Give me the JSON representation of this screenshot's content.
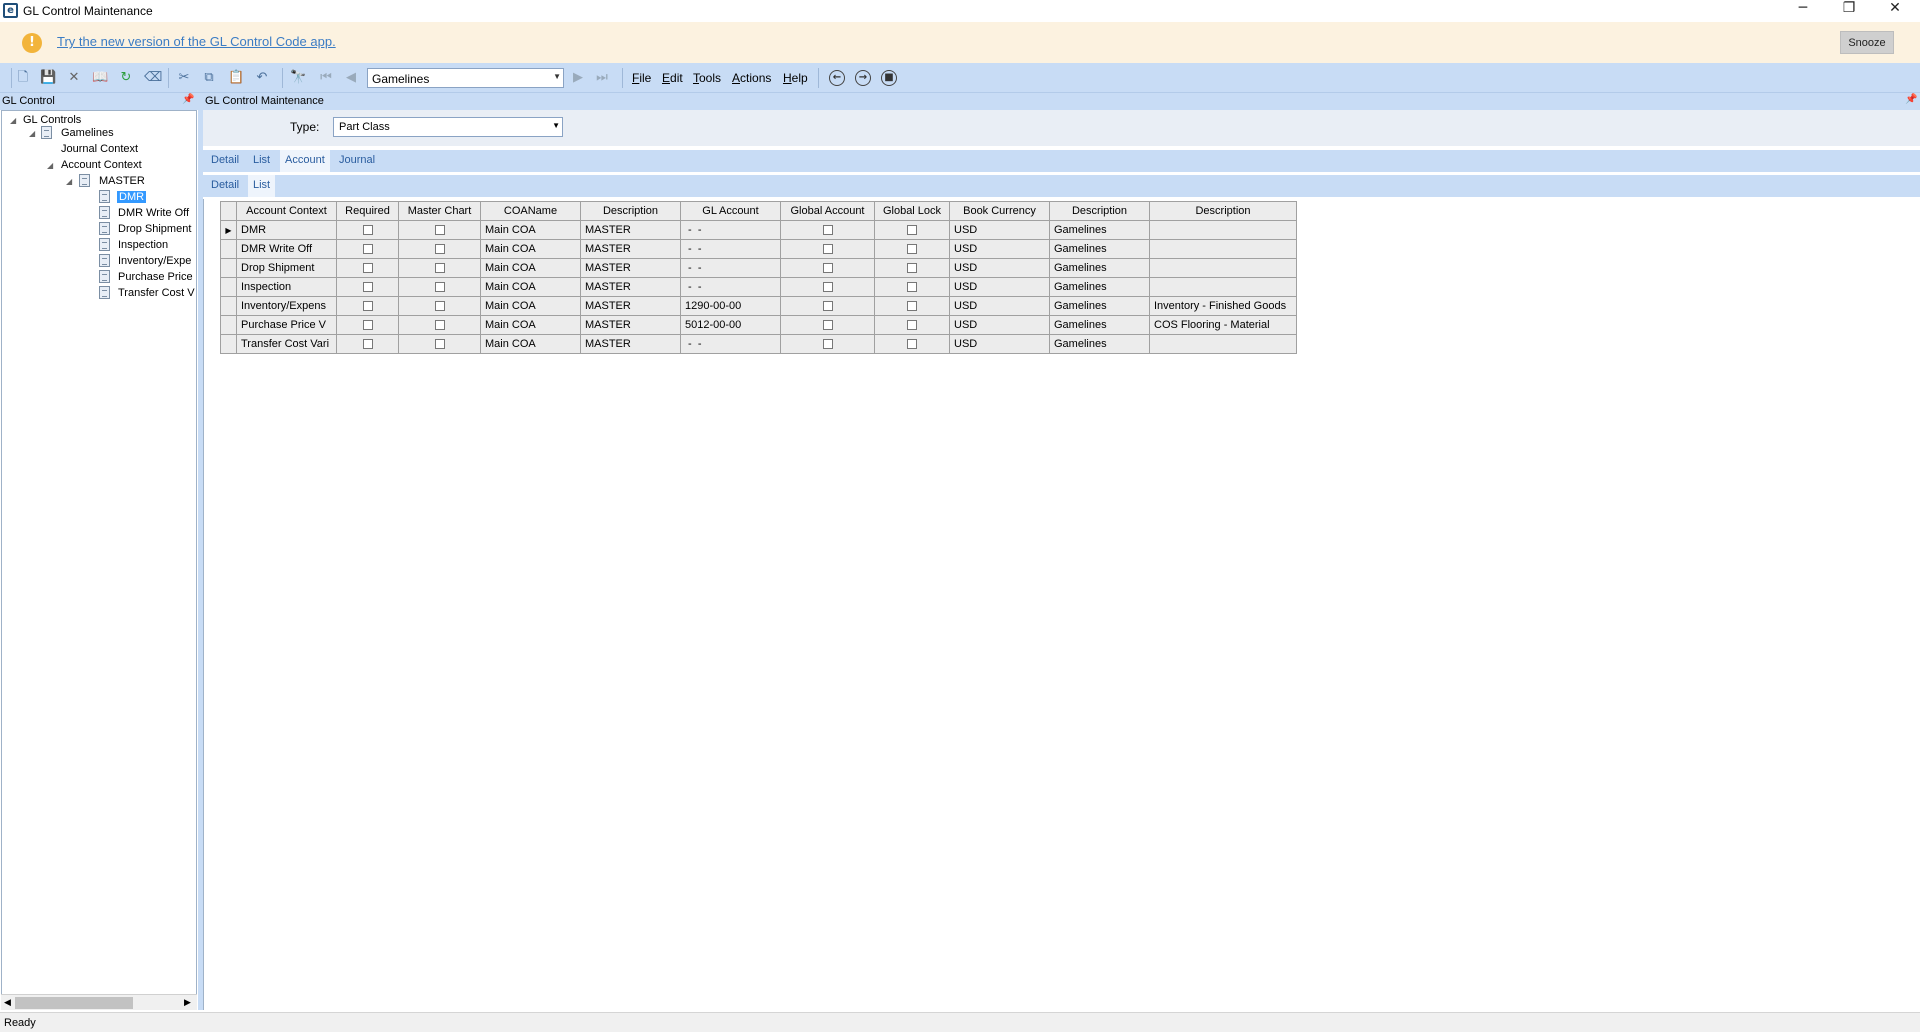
{
  "window": {
    "title": "GL Control Maintenance",
    "minimize": "─",
    "restore": "❐",
    "close": "✕"
  },
  "banner": {
    "icon": "!",
    "link_text": "Try the new version of the GL Control Code app.",
    "snooze_label": "Snooze"
  },
  "toolbar": {
    "combo_value": "Gamelines",
    "menus": [
      "File",
      "Edit",
      "Tools",
      "Actions",
      "Help"
    ]
  },
  "left_panel": {
    "header": "GL Control",
    "tree": {
      "root": "GL Controls",
      "gamelines": "Gamelines",
      "journal_context": "Journal Context",
      "account_context": "Account Context",
      "master": "MASTER",
      "items": [
        "DMR",
        "DMR Write Off",
        "Drop Shipment",
        "Inspection",
        "Inventory/Expe",
        "Purchase Price",
        "Transfer Cost V"
      ]
    }
  },
  "right_panel": {
    "header": "GL Control Maintenance",
    "type_label": "Type:",
    "type_value": "Part Class",
    "tabs1": [
      "Detail",
      "List",
      "Account",
      "Journal"
    ],
    "tabs2": [
      "Detail",
      "List"
    ]
  },
  "grid": {
    "columns": [
      "Account Context",
      "Required",
      "Master Chart",
      "COAName",
      "Description",
      "GL Account",
      "Global Account",
      "Global Lock",
      "Book Currency",
      "Description",
      "Description"
    ],
    "rows": [
      {
        "context": "DMR",
        "coa": "Main COA",
        "desc": "MASTER",
        "gl": " -  -",
        "currency": "USD",
        "book_desc": "Gamelines",
        "acct_desc": ""
      },
      {
        "context": "DMR Write Off",
        "coa": "Main COA",
        "desc": "MASTER",
        "gl": " -  -",
        "currency": "USD",
        "book_desc": "Gamelines",
        "acct_desc": ""
      },
      {
        "context": "Drop Shipment",
        "coa": "Main COA",
        "desc": "MASTER",
        "gl": " -  -",
        "currency": "USD",
        "book_desc": "Gamelines",
        "acct_desc": ""
      },
      {
        "context": "Inspection",
        "coa": "Main COA",
        "desc": "MASTER",
        "gl": " -  -",
        "currency": "USD",
        "book_desc": "Gamelines",
        "acct_desc": ""
      },
      {
        "context": "Inventory/Expens",
        "coa": "Main COA",
        "desc": "MASTER",
        "gl": "1290-00-00",
        "currency": "USD",
        "book_desc": "Gamelines",
        "acct_desc": "Inventory - Finished Goods"
      },
      {
        "context": "Purchase Price V",
        "coa": "Main COA",
        "desc": "MASTER",
        "gl": "5012-00-00",
        "currency": "USD",
        "book_desc": "Gamelines",
        "acct_desc": "COS Flooring - Material"
      },
      {
        "context": "Transfer Cost Vari",
        "coa": "Main COA",
        "desc": "MASTER",
        "gl": " -  -",
        "currency": "USD",
        "book_desc": "Gamelines",
        "acct_desc": ""
      }
    ]
  },
  "status": "Ready"
}
